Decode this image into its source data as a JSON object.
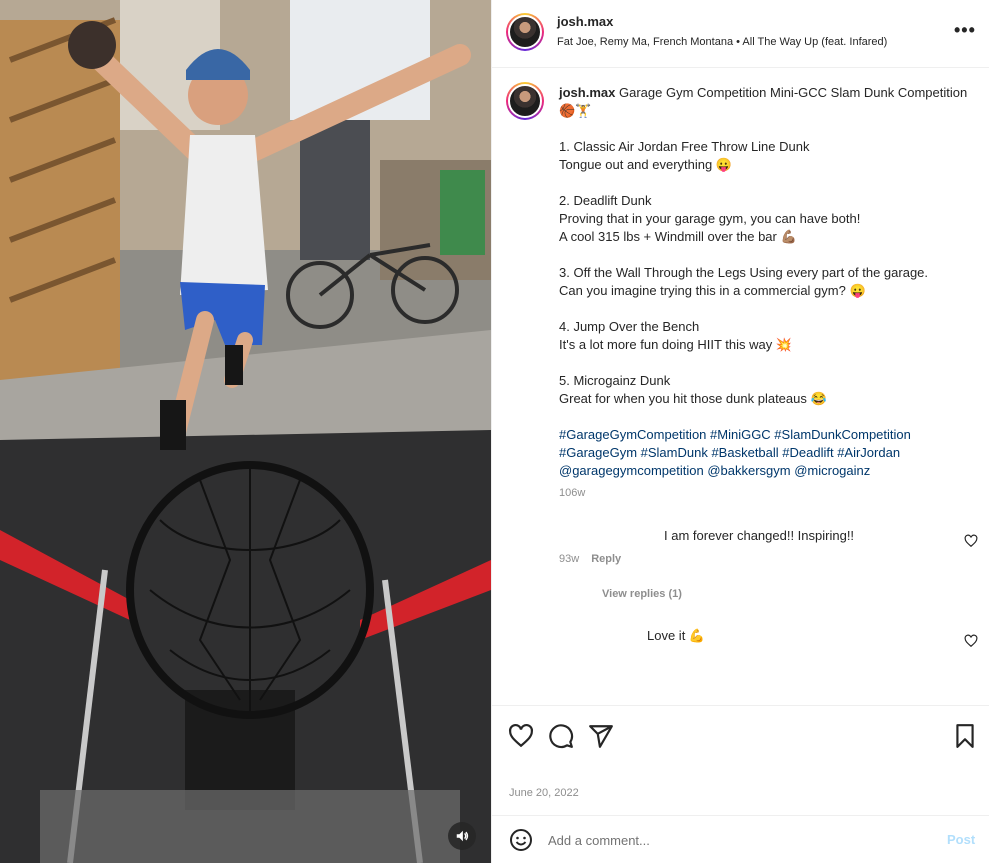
{
  "post": {
    "username": "josh.max",
    "audio": "Fat Joe, Remy Ma, French Montana • All The Way Up (feat. Infared)",
    "more_icon": "more-horizontal-icon",
    "caption": {
      "username": "josh.max",
      "title": "Garage Gym Competition Mini-GCC Slam Dunk Competition 🏀🏋",
      "p1": "1. Classic Air Jordan Free Throw Line Dunk\nTongue out and everything 😛",
      "p2": "2. Deadlift Dunk\nProving that in your garage gym, you can have both!\nA cool 315 lbs + Windmill over the bar 💪🏽",
      "p3": "3. Off the Wall Through the Legs Using every part of the garage.\nCan you imagine trying this in a commercial gym? 😛",
      "p4": "4. Jump Over the Bench\nIt's a lot more fun doing HIIT this way 💥",
      "p5": "5. Microgainz Dunk\nGreat for when you hit those dunk plateaus 😂",
      "tags": "#GarageGymCompetition #MiniGGC #SlamDunkCompetition #GarageGym #SlamDunk #Basketball #Deadlift #AirJordan @garagegymcompetition @bakkersgym @microgainz",
      "time": "106w"
    },
    "comments": [
      {
        "text": "I am forever changed!! Inspiring!!",
        "time": "93w",
        "reply_label": "Reply"
      },
      {
        "text": "Love it 💪"
      }
    ],
    "view_replies": "View replies (1)",
    "date": "June 20, 2022",
    "comment_placeholder": "Add a comment...",
    "post_label": "Post"
  },
  "icons": {
    "like": "heart-icon",
    "comment": "comment-icon",
    "share": "share-icon",
    "save": "bookmark-icon",
    "emoji": "emoji-icon",
    "audio": "speaker-icon"
  },
  "colors": {
    "text": "#262626",
    "secondary": "#8e8e8e",
    "link": "#00376b",
    "post_disabled": "#b2dffc"
  }
}
